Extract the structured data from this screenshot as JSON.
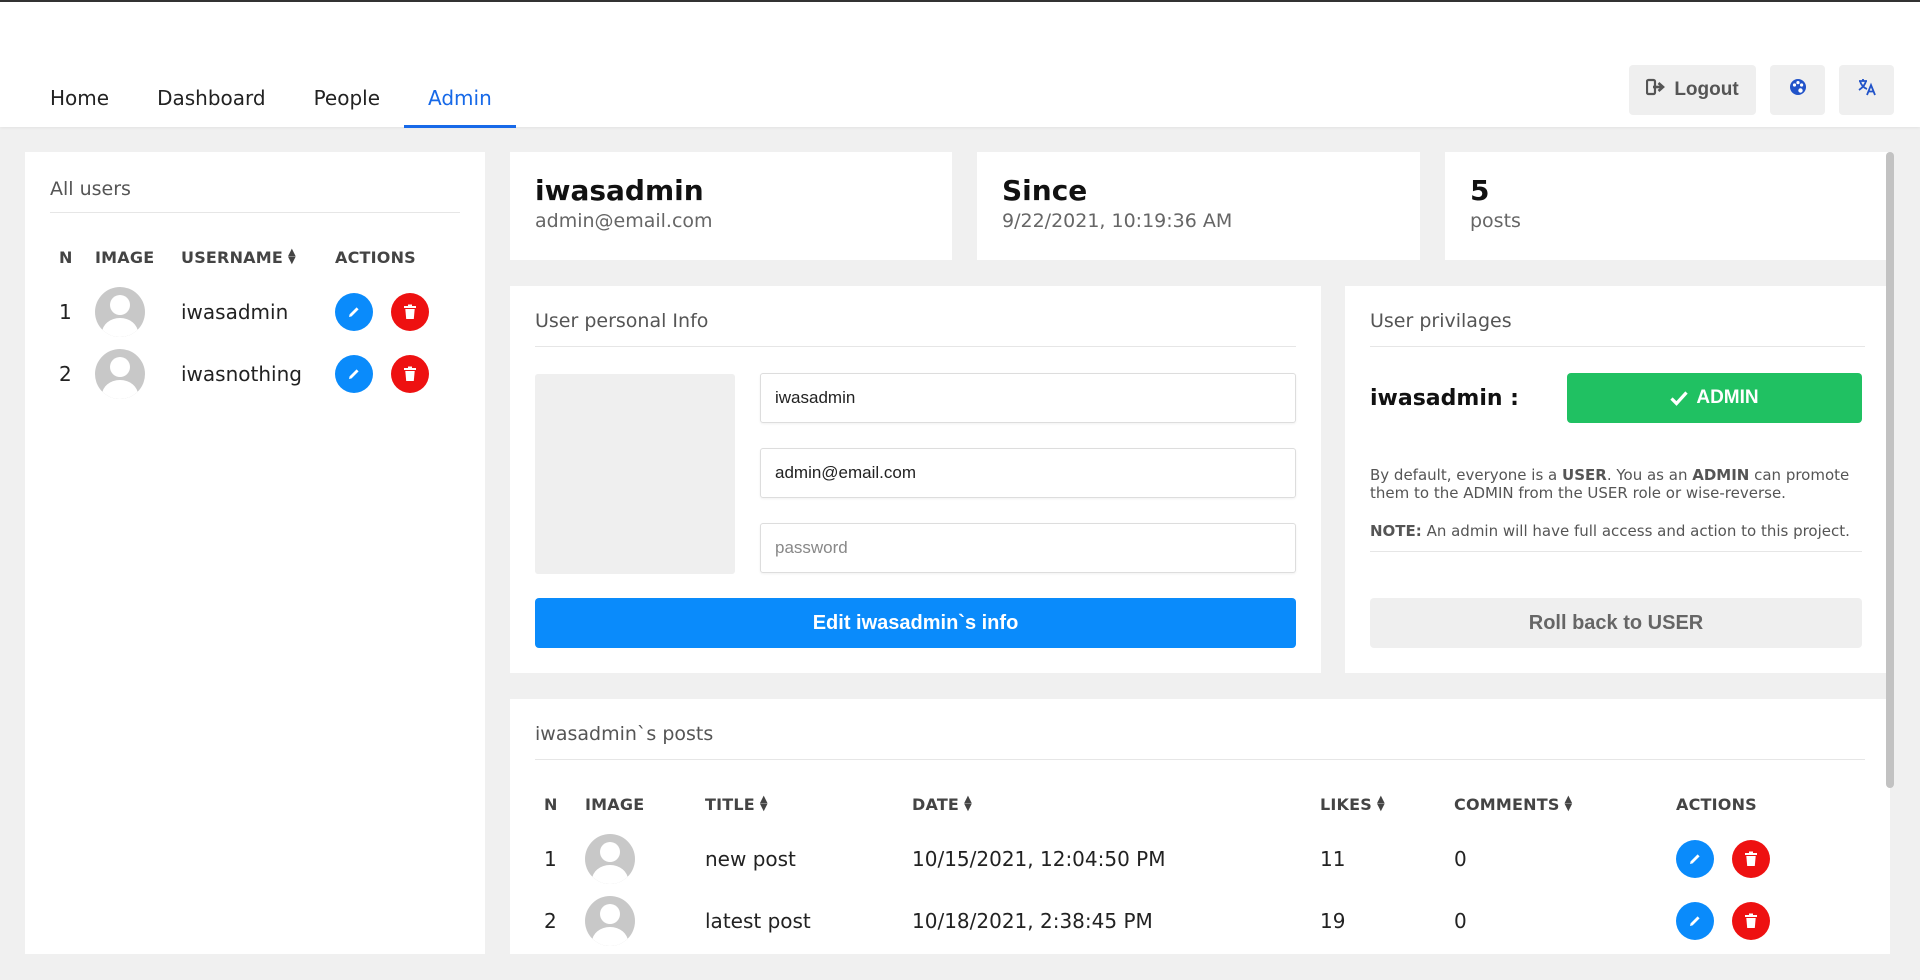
{
  "nav": {
    "tabs": [
      {
        "label": "Home"
      },
      {
        "label": "Dashboard"
      },
      {
        "label": "People"
      },
      {
        "label": "Admin",
        "active": true
      }
    ],
    "logout_label": "Logout",
    "theme_icon": "palette-icon",
    "language_icon": "translate-icon"
  },
  "users": {
    "title": "All users",
    "columns": [
      "N",
      "IMAGE",
      "USERNAME",
      "ACTIONS"
    ],
    "rows": [
      {
        "n": "1",
        "username": "iwasadmin"
      },
      {
        "n": "2",
        "username": "iwasnothing"
      }
    ]
  },
  "stats": {
    "user": {
      "big": "iwasadmin",
      "small": "admin@email.com"
    },
    "since": {
      "big": "Since",
      "small": "9/22/2021, 10:19:36 AM"
    },
    "posts": {
      "big": "5",
      "small": "posts"
    }
  },
  "info": {
    "title": "User personal Info",
    "username_value": "iwasadmin",
    "email_value": "admin@email.com",
    "password_placeholder": "password",
    "edit_button": "Edit iwasadmin`s info"
  },
  "privileges": {
    "title": "User privilages",
    "name_label": "iwasadmin :",
    "role_button": "ADMIN",
    "text_1": "By default, everyone is a ",
    "text_user": "USER",
    "text_2": ". You as an ",
    "text_admin": "ADMIN",
    "text_3": " can promote them to the ADMIN from the USER role or wise-reverse.",
    "note_label": "NOTE:",
    "note_text": " An admin will have full access and action to this project.",
    "rollback_button": "Roll back to USER"
  },
  "posts": {
    "title": "iwasadmin`s posts",
    "columns": [
      "N",
      "IMAGE",
      "TITLE",
      "DATE",
      "LIKES",
      "COMMENTS",
      "ACTIONS"
    ],
    "rows": [
      {
        "n": "1",
        "title": "new post",
        "date": "10/15/2021, 12:04:50 PM",
        "likes": "11",
        "comments": "0"
      },
      {
        "n": "2",
        "title": "latest post",
        "date": "10/18/2021, 2:38:45 PM",
        "likes": "19",
        "comments": "0"
      }
    ]
  },
  "colors": {
    "accent": "#1769e8",
    "edit": "#0a8bfb",
    "delete": "#ee1111",
    "admin_green": "#20c162"
  }
}
